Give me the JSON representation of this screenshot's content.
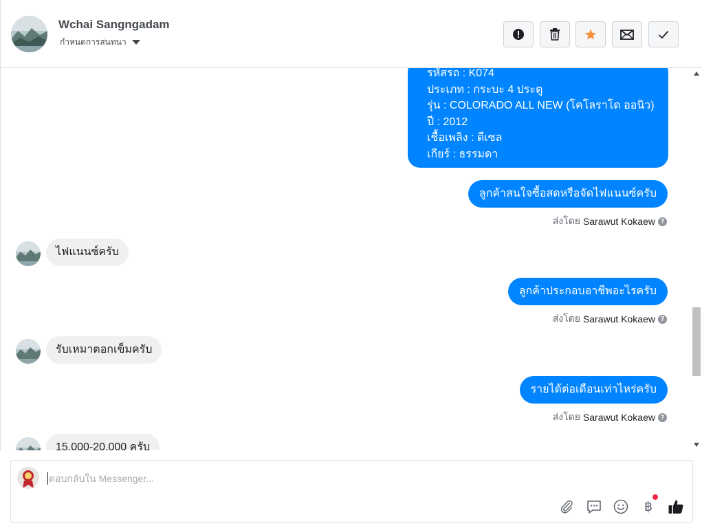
{
  "header": {
    "name": "Wchai Sangngadam",
    "subtitle": "กำหนดการสนทนา",
    "buttons": [
      "exclamation-icon",
      "trash-icon",
      "star-icon",
      "envelope-icon",
      "check-icon"
    ],
    "star_color": "#f7923b"
  },
  "card": {
    "lines": [
      "รหัสรถ : K074",
      "ประเภท : กระบะ 4 ประตู",
      "รุ่น : COLORADO ALL NEW (โคโลราโด ออนิว)",
      "ปี : 2012",
      "เชื้อเพลิง : ดีเซล",
      "เกียร์ : ธรรมดา"
    ]
  },
  "messages": [
    {
      "dir": "out",
      "text": "ลูกค้าสนใจซื้อสดหรือจัดไฟแนนซ์ครับ",
      "sent_by_label": "ส่งโดย",
      "sent_by_name": "Sarawut Kokaew"
    },
    {
      "dir": "in",
      "text": "ไฟแนนซ์ครับ"
    },
    {
      "dir": "out",
      "text": "ลูกค้าประกอบอาชีพอะไรครับ",
      "sent_by_label": "ส่งโดย",
      "sent_by_name": "Sarawut Kokaew"
    },
    {
      "dir": "in",
      "text": "รับเหมาตอกเข็มครับ"
    },
    {
      "dir": "out",
      "text": "รายได้ต่อเดือนเท่าไหร่ครับ",
      "sent_by_label": "ส่งโดย",
      "sent_by_name": "Sarawut Kokaew"
    },
    {
      "dir": "in",
      "text": "15,000-20,000 ครับ"
    }
  ],
  "composer": {
    "placeholder": "ตอบกลับใน Messenger...",
    "tools": [
      "paperclip-icon",
      "chat-bubble-icon",
      "smiley-icon",
      "baht-icon",
      "thumbs-up-icon"
    ],
    "baht_glyph": "฿"
  },
  "colors": {
    "accent": "#0084ff",
    "incoming_bubble": "#f1f0f0",
    "notification_dot": "#f02849"
  }
}
